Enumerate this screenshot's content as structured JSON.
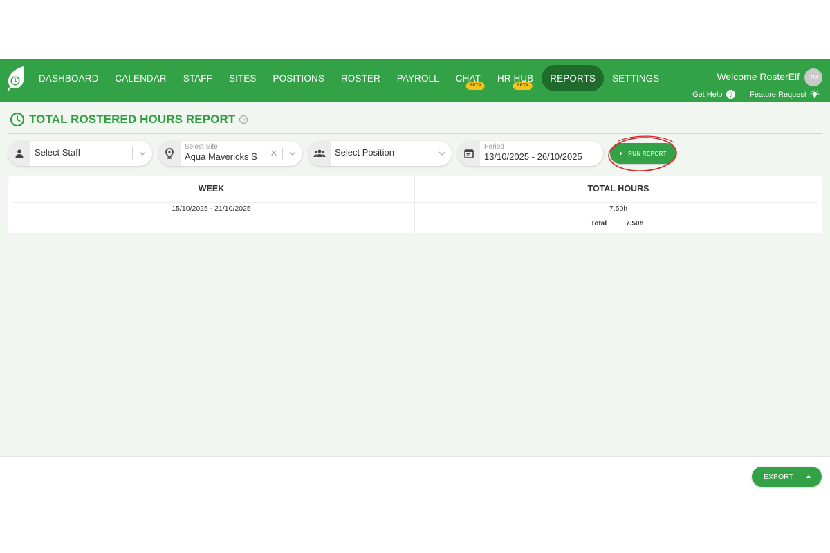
{
  "nav": {
    "items": [
      {
        "label": "DASHBOARD"
      },
      {
        "label": "CALENDAR"
      },
      {
        "label": "STAFF"
      },
      {
        "label": "SITES"
      },
      {
        "label": "POSITIONS"
      },
      {
        "label": "ROSTER"
      },
      {
        "label": "PAYROLL"
      },
      {
        "label": "CHAT",
        "badge": "BETA"
      },
      {
        "label": "HR HUB",
        "badge": "BETA"
      },
      {
        "label": "REPORTS"
      },
      {
        "label": "SETTINGS"
      }
    ],
    "active": "REPORTS",
    "welcome": "Welcome RosterElf",
    "avatar_initials": "RM",
    "get_help": "Get Help",
    "help_icon": "question-icon",
    "feature_request": "Feature Request",
    "feature_icon": "lightbulb-icon"
  },
  "page": {
    "title": "TOTAL ROSTERED HOURS REPORT",
    "title_icon": "clock-icon"
  },
  "filters": {
    "staff": {
      "placeholder": "Select Staff",
      "icon": "person-icon"
    },
    "site": {
      "label": "Select Site",
      "value": "Aqua Mavericks S",
      "icon": "location-pin-icon"
    },
    "position": {
      "placeholder": "Select Position",
      "icon": "people-icon"
    },
    "period": {
      "label": "Period",
      "value": "13/10/2025 - 26/10/2025",
      "icon": "calendar-icon"
    },
    "run_label": "RUN REPORT"
  },
  "table": {
    "headers": [
      "WEEK",
      "TOTAL HOURS"
    ],
    "rows": [
      {
        "week": "15/10/2025 - 21/10/2025",
        "hours": "7.50h"
      }
    ],
    "total_label": "Total",
    "total_value": "7.50h"
  },
  "footer": {
    "export_label": "EXPORT"
  },
  "colors": {
    "brand_green": "#33a145",
    "active_nav": "#1f6b2c",
    "beta_badge": "#f3c21b",
    "annotation_circle": "#d9262c"
  }
}
